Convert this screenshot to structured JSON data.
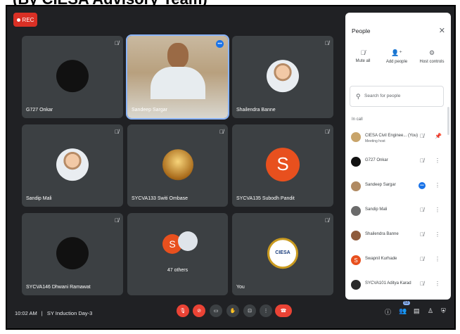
{
  "banner": {
    "title": "(By CIESA Advisory Team)"
  },
  "rec": {
    "label": "REC"
  },
  "tiles": [
    {
      "name": "G727 Onkar"
    },
    {
      "name": "Sandeep Sargar"
    },
    {
      "name": "Shailendra Banne"
    },
    {
      "name": "Sandip Mali"
    },
    {
      "name": "SYCVA133 Switi Ombase"
    },
    {
      "name": "SYCVA135 Subodh Pandit",
      "initial": "S"
    },
    {
      "name": "SYCVA146 Dhwani Ramawat"
    },
    {
      "name": "",
      "initial": "S",
      "others": "47 others"
    },
    {
      "name": "You",
      "logo_text": "CIESA"
    }
  ],
  "panel": {
    "title": "People",
    "actions": [
      "Mute all",
      "Add people",
      "Host controls"
    ],
    "search_placeholder": "Search for people",
    "section": "In call",
    "people": [
      {
        "name": "CIESA Civil Enginee... (You)",
        "sub": "Meeting host"
      },
      {
        "name": "G727 Onkar"
      },
      {
        "name": "Sandeep Sargar"
      },
      {
        "name": "Sandip Mali"
      },
      {
        "name": "Shailendra Banne"
      },
      {
        "name": "Swapnil Kurhade",
        "initial": "S"
      },
      {
        "name": "SYCVA101 Aditya Karad"
      }
    ]
  },
  "bottom": {
    "time": "10:02 AM",
    "separator": "|",
    "meeting": "SY Induction Day-3",
    "people_count": "53"
  },
  "colors": {
    "background": "#202124",
    "tile": "#3c4043",
    "red": "#ea4335",
    "accent": "#1a73e8",
    "avatar_orange": "#e8501e"
  }
}
